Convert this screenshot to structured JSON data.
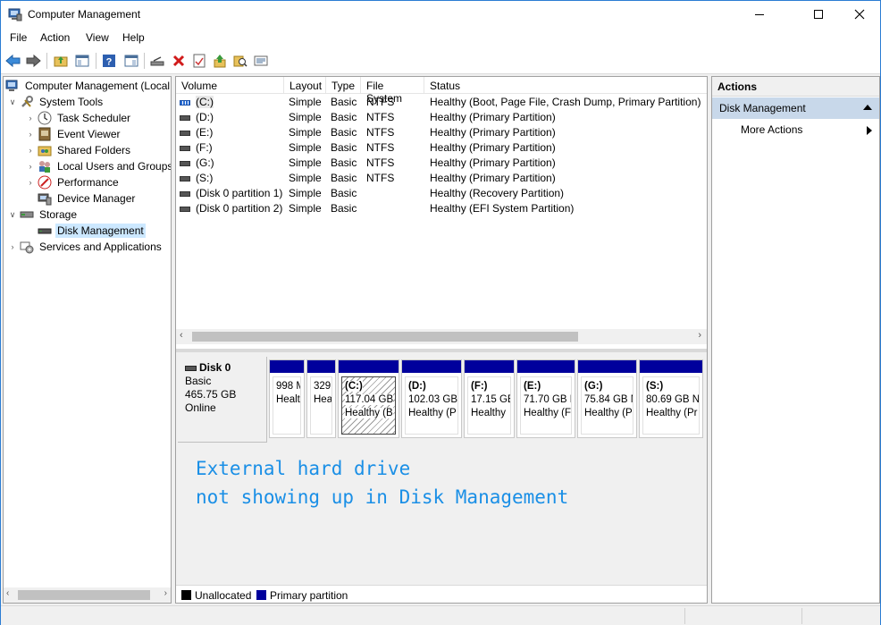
{
  "window": {
    "title": "Computer Management"
  },
  "menu": [
    "File",
    "Action",
    "View",
    "Help"
  ],
  "toolbar": [
    "back-icon",
    "forward-icon",
    "up-folder-icon",
    "show-hide-tree-icon",
    "help-icon",
    "show-action-pane-icon",
    "connect-icon",
    "delete-icon",
    "properties-icon",
    "import-icon",
    "search-icon",
    "details-icon"
  ],
  "tree": {
    "root": "Computer Management (Local",
    "system_tools": "System Tools",
    "task_scheduler": "Task Scheduler",
    "event_viewer": "Event Viewer",
    "shared_folders": "Shared Folders",
    "local_users": "Local Users and Groups",
    "performance": "Performance",
    "device_manager": "Device Manager",
    "storage": "Storage",
    "disk_management": "Disk Management",
    "services": "Services and Applications"
  },
  "volumes": {
    "columns": [
      "Volume",
      "Layout",
      "Type",
      "File System",
      "Status"
    ],
    "rows": [
      {
        "volume": "(C:)",
        "layout": "Simple",
        "type": "Basic",
        "fs": "NTFS",
        "status": "Healthy (Boot, Page File, Crash Dump, Primary Partition)"
      },
      {
        "volume": "(D:)",
        "layout": "Simple",
        "type": "Basic",
        "fs": "NTFS",
        "status": "Healthy (Primary Partition)"
      },
      {
        "volume": "(E:)",
        "layout": "Simple",
        "type": "Basic",
        "fs": "NTFS",
        "status": "Healthy (Primary Partition)"
      },
      {
        "volume": "(F:)",
        "layout": "Simple",
        "type": "Basic",
        "fs": "NTFS",
        "status": "Healthy (Primary Partition)"
      },
      {
        "volume": "(G:)",
        "layout": "Simple",
        "type": "Basic",
        "fs": "NTFS",
        "status": "Healthy (Primary Partition)"
      },
      {
        "volume": "(S:)",
        "layout": "Simple",
        "type": "Basic",
        "fs": "NTFS",
        "status": "Healthy (Primary Partition)"
      },
      {
        "volume": "(Disk 0 partition 1)",
        "layout": "Simple",
        "type": "Basic",
        "fs": "",
        "status": "Healthy (Recovery Partition)"
      },
      {
        "volume": "(Disk 0 partition 2)",
        "layout": "Simple",
        "type": "Basic",
        "fs": "",
        "status": "Healthy (EFI System Partition)"
      }
    ]
  },
  "disk": {
    "name": "Disk 0",
    "type": "Basic",
    "size": "465.75 GB",
    "state": "Online",
    "partitions": [
      {
        "name": "",
        "size": "998 M",
        "status": "Healt"
      },
      {
        "name": "",
        "size": "329",
        "status": "Hea"
      },
      {
        "name": "(C:)",
        "size": "117.04 GB",
        "status": "Healthy (B"
      },
      {
        "name": "(D:)",
        "size": "102.03 GB",
        "status": "Healthy (P"
      },
      {
        "name": "(F:)",
        "size": "17.15 GE",
        "status": "Healthy"
      },
      {
        "name": "(E:)",
        "size": "71.70 GB N",
        "status": "Healthy (F"
      },
      {
        "name": "(G:)",
        "size": "75.84 GB N",
        "status": "Healthy (P"
      },
      {
        "name": "(S:)",
        "size": "80.69 GB N",
        "status": "Healthy (Pr"
      }
    ]
  },
  "overlay": {
    "line1": "External hard drive",
    "line2": "not showing up in Disk Management"
  },
  "legend": {
    "unallocated": "Unallocated",
    "primary": "Primary partition",
    "unallocated_color": "#000000",
    "primary_color": "#00009c"
  },
  "actions": {
    "header": "Actions",
    "section": "Disk Management",
    "item": "More Actions"
  }
}
